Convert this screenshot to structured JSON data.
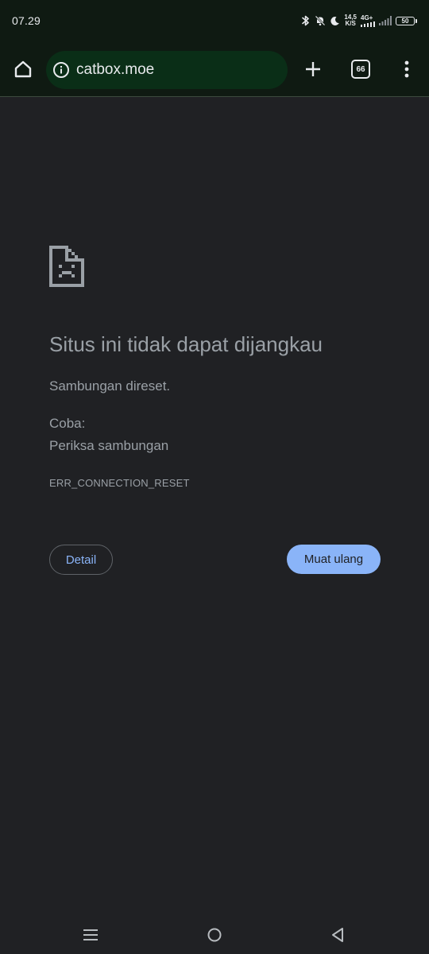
{
  "status_bar": {
    "time": "07.29",
    "speed_value": "14,5",
    "speed_unit": "K/S",
    "network_type": "4G+",
    "battery": "50",
    "icons": [
      "bluetooth-icon",
      "bell-off-icon",
      "moon-icon",
      "signal-4g-icon",
      "signal-bars-icon",
      "battery-icon"
    ]
  },
  "toolbar": {
    "url": "catbox.moe",
    "tab_count": "66",
    "icons": [
      "home-icon",
      "info-icon",
      "plus-icon",
      "tabs-icon",
      "more-vert-icon"
    ]
  },
  "error_page": {
    "icon": "sad-page-icon",
    "title": "Situs ini tidak dapat dijangkau",
    "description": "Sambungan direset.",
    "try_label": "Coba:",
    "suggestion": "Periksa sambungan",
    "error_code": "ERR_CONNECTION_RESET",
    "details_label": "Detail",
    "reload_label": "Muat ulang"
  },
  "nav_bar": {
    "icons": [
      "recent-apps-icon",
      "home-circle-icon",
      "back-triangle-icon"
    ]
  },
  "colors": {
    "page_background": "#202124",
    "toolbar_background": "#0f1a12",
    "omnibox_background": "#0a2e17",
    "text_secondary": "#9aa0a6",
    "accent_blue": "#8ab4f8"
  }
}
